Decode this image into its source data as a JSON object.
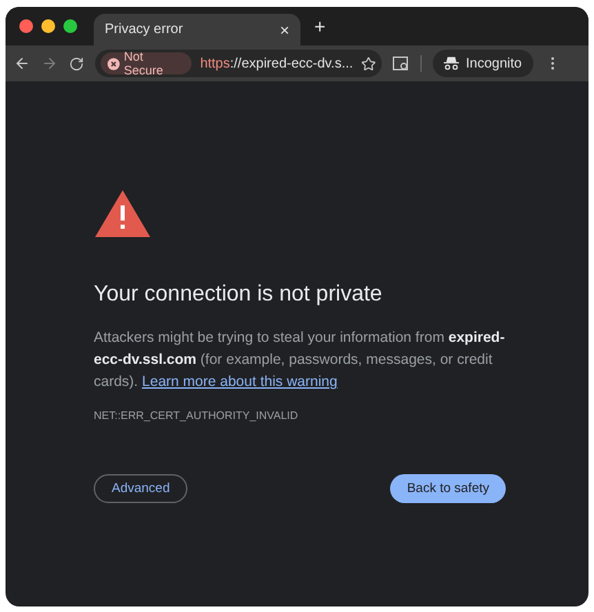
{
  "tab": {
    "title": "Privacy error",
    "close": "×"
  },
  "new_tab": "+",
  "address_bar": {
    "security_chip": "Not Secure",
    "url_scheme": "https",
    "url_rest": "://expired-ecc-dv.s..."
  },
  "profile": {
    "label": "Incognito"
  },
  "page": {
    "title": "Your connection is not private",
    "paragraph": "Attackers might be trying to steal your information from **expired-ecc-dv.ssl.com** (for example, passwords, messages, or credit cards).",
    "link": "Learn more about this warning",
    "error_code": "NET::ERR_CERT_AUTHORITY_INVALID",
    "buttons": [
      {
        "label": "Advanced",
        "kind": "outline"
      },
      {
        "label": "Back to safety",
        "kind": "primary"
      }
    ]
  }
}
